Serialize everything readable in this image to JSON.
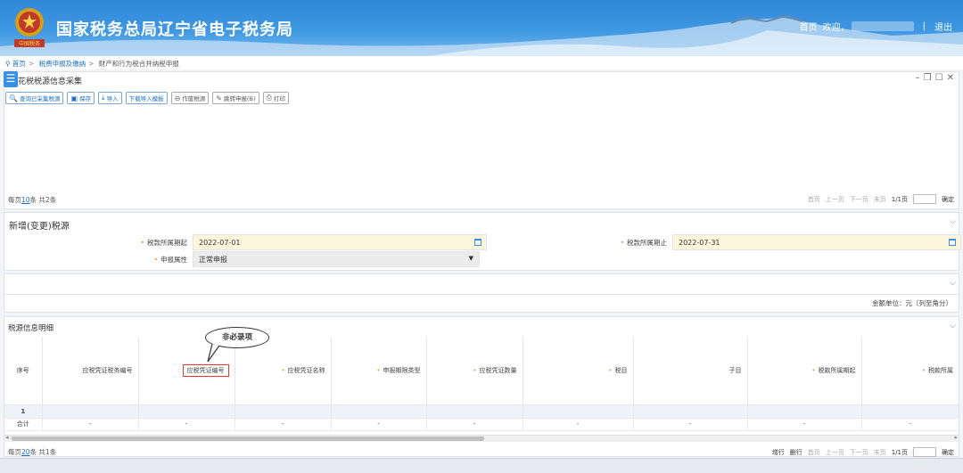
{
  "header": {
    "site_title": "国家税务总局辽宁省电子税务局",
    "emblem_text": "中国税务",
    "home_link": "首页",
    "welcome": "欢迎，",
    "logout": "退出"
  },
  "breadcrumb": {
    "home": "首页",
    "level2": "税费申报及缴纳",
    "current": "财产和行为税合并纳税申报"
  },
  "collect_panel": {
    "title": "花税税源信息采集",
    "toolbar": [
      {
        "icon": "search-icon",
        "glyph": "🔍",
        "label": "查询已采集税源"
      },
      {
        "icon": "save-icon",
        "glyph": "▣",
        "label": "保存"
      },
      {
        "icon": "import-icon",
        "glyph": "⤓",
        "label": "导入"
      },
      {
        "icon": "download-template-icon",
        "glyph": "",
        "label": "下载导入模板"
      },
      {
        "icon": "void-icon",
        "glyph": "⊖",
        "label": "作废税源"
      },
      {
        "icon": "edit-icon",
        "glyph": "✎",
        "label": "跳转申报(B)"
      },
      {
        "icon": "print-icon",
        "glyph": "⎙",
        "label": "打印"
      }
    ],
    "page_info_prefix": "每页",
    "page_size": "10",
    "page_info_suffix": "条 共2条",
    "pager": {
      "first": "首页",
      "prev": "上一页",
      "next": "下一页",
      "last": "末页",
      "current": "1/1页",
      "go": "确定"
    }
  },
  "new_source": {
    "title": "新增(变更)税源",
    "period_start_label": "税款所属期起",
    "period_start_value": "2022-07-01",
    "period_end_label": "税款所属期止",
    "period_end_value": "2022-07-31",
    "attr_label": "申报属性",
    "attr_value": "正常申报"
  },
  "amount_unit": "金额单位：元（列至角分）",
  "detail": {
    "title": "税源信息明细",
    "callout": "非必录项",
    "columns": [
      "序号",
      "应税凭证税务编号",
      "应税凭证编号",
      "应税凭证名称",
      "申报期限类型",
      "应税凭证数量",
      "税目",
      "子目",
      "税款所属期起",
      "税款所属"
    ],
    "row1_index": "1",
    "total_label": "合计",
    "total_dash": "-",
    "page_info_prefix": "每页",
    "page_size": "20",
    "page_info_suffix": "条 共1条",
    "pager": {
      "add_row": "增行",
      "del_row": "删行",
      "first": "首页",
      "prev": "上一页",
      "next": "下一页",
      "last": "末页",
      "current": "1/1页",
      "go": "确定"
    }
  },
  "colors": {
    "accent": "#3a8ee6",
    "required": "#f39c4a",
    "highlight": "#e53935"
  }
}
